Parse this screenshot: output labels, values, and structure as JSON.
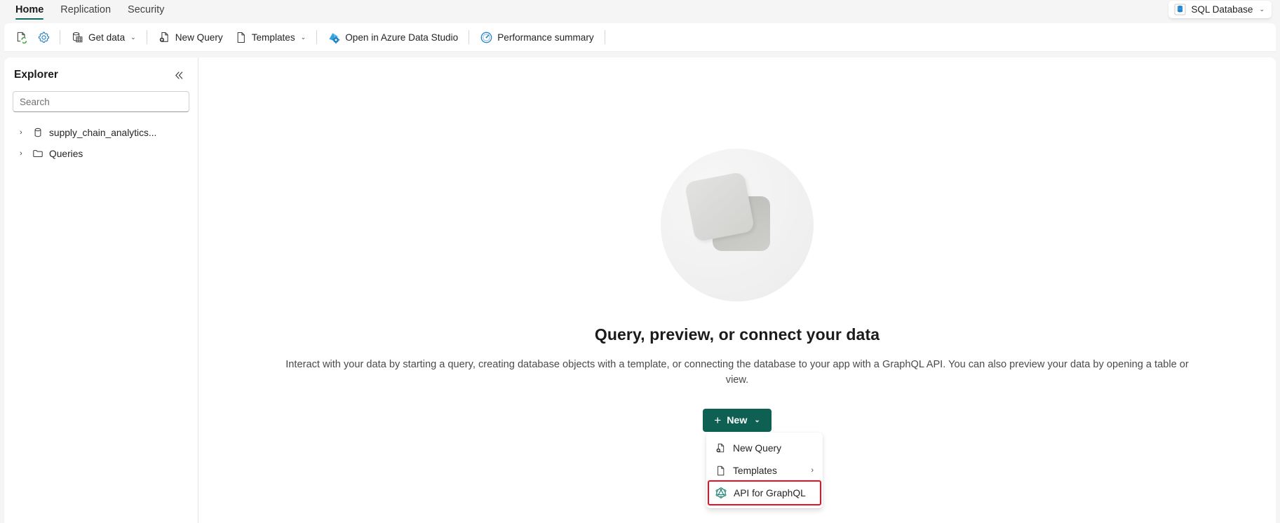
{
  "ribbon": {
    "tabs": [
      {
        "label": "Home",
        "active": true
      },
      {
        "label": "Replication",
        "active": false
      },
      {
        "label": "Security",
        "active": false
      }
    ],
    "workload_switcher": {
      "label": "SQL Database",
      "icon": "sql-database-icon",
      "chevron": "⌄"
    },
    "accent_color": "#0f6b5f"
  },
  "toolbar": {
    "refresh_label": "Refresh",
    "settings_label": "Settings",
    "get_data_label": "Get data",
    "new_query_label": "New Query",
    "templates_label": "Templates",
    "open_in_ads_label": "Open in Azure Data Studio",
    "performance_summary_label": "Performance summary",
    "chevron": "⌄"
  },
  "explorer": {
    "title": "Explorer",
    "collapse_icon": "«",
    "search": {
      "placeholder": "Search",
      "value": ""
    },
    "tree": [
      {
        "label": "supply_chain_analytics...",
        "icon": "database-icon",
        "arrow": "›"
      },
      {
        "label": "Queries",
        "icon": "folder-icon",
        "arrow": "›"
      }
    ]
  },
  "main": {
    "empty_state": {
      "title": "Query, preview, or connect your data",
      "description": "Interact with your data by starting a query, creating database objects with a template, or connecting the database to your app with a GraphQL API. You can also preview your data by opening a table or view.",
      "illustration": "stacked-squares-illustration"
    },
    "new_button": {
      "label": "New",
      "plus": "+",
      "chevron": "⌄",
      "color": "#0e6152"
    },
    "new_menu": {
      "items": [
        {
          "label": "New Query",
          "icon": "new-query-icon",
          "submenu_arrow": "",
          "highlighted": false
        },
        {
          "label": "Templates",
          "icon": "templates-icon",
          "submenu_arrow": "›",
          "highlighted": false
        },
        {
          "label": "API for GraphQL",
          "icon": "graphql-icon",
          "submenu_arrow": "",
          "highlighted": true
        }
      ],
      "highlight_color": "#e81123"
    }
  }
}
